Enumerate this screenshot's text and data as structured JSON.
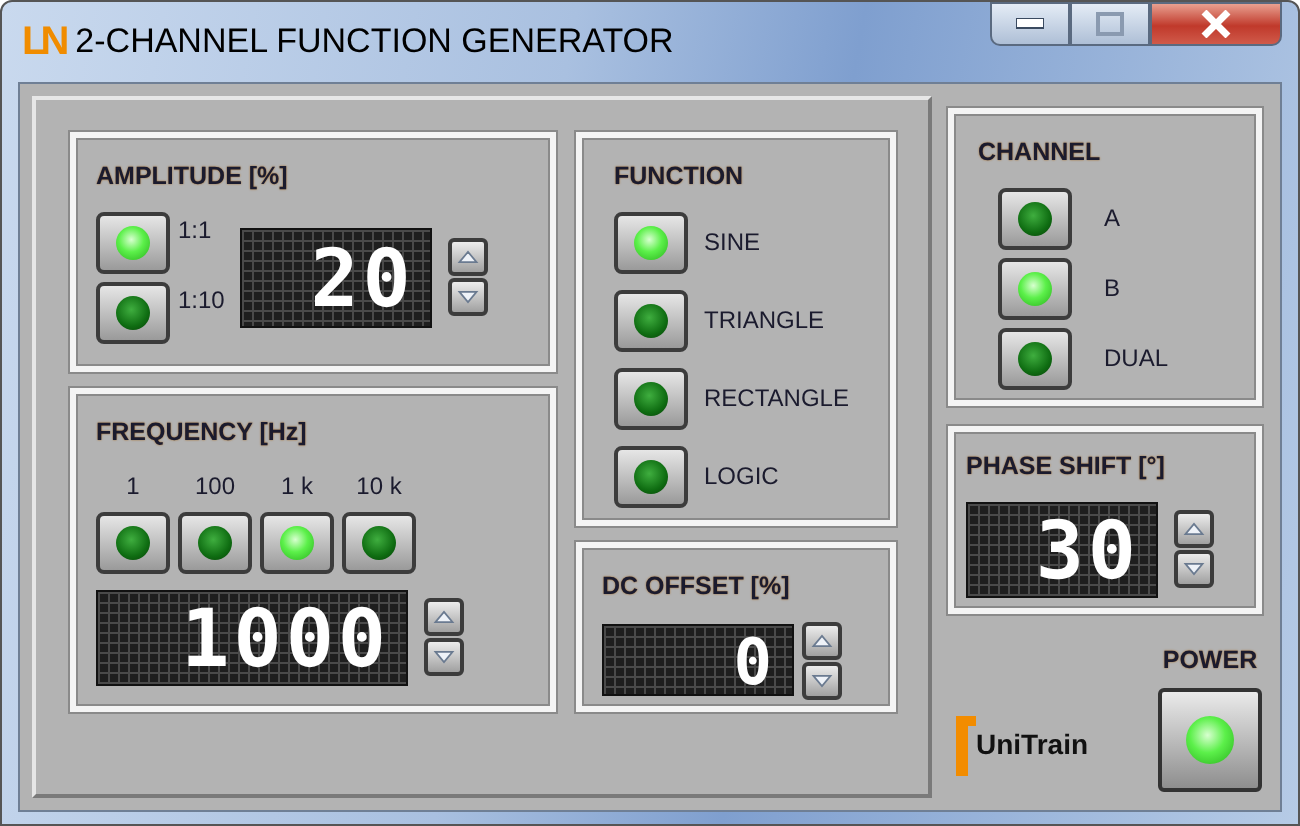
{
  "window": {
    "logo": "LN",
    "title": "2-CHANNEL FUNCTION GENERATOR"
  },
  "amplitude": {
    "title": "AMPLITUDE [%]",
    "ranges": [
      {
        "label": "1:1",
        "selected": true
      },
      {
        "label": "1:10",
        "selected": false
      }
    ],
    "display": "20"
  },
  "frequency": {
    "title": "FREQUENCY [Hz]",
    "ranges": [
      {
        "label": "1",
        "selected": false
      },
      {
        "label": "100",
        "selected": false
      },
      {
        "label": "1 k",
        "selected": true
      },
      {
        "label": "10 k",
        "selected": false
      }
    ],
    "display": "1000"
  },
  "function": {
    "title": "FUNCTION",
    "options": [
      {
        "label": "SINE",
        "selected": true
      },
      {
        "label": "TRIANGLE",
        "selected": false
      },
      {
        "label": "RECTANGLE",
        "selected": false
      },
      {
        "label": "LOGIC",
        "selected": false
      }
    ]
  },
  "dc_offset": {
    "title": "DC OFFSET [%]",
    "display": "0"
  },
  "channel": {
    "title": "CHANNEL",
    "options": [
      {
        "label": "A",
        "selected": false
      },
      {
        "label": "B",
        "selected": true
      },
      {
        "label": "DUAL",
        "selected": false
      }
    ]
  },
  "phase_shift": {
    "title": "PHASE SHIFT [°]",
    "display": "30"
  },
  "brand": "UniTrain",
  "power": {
    "label": "POWER",
    "on": true
  }
}
